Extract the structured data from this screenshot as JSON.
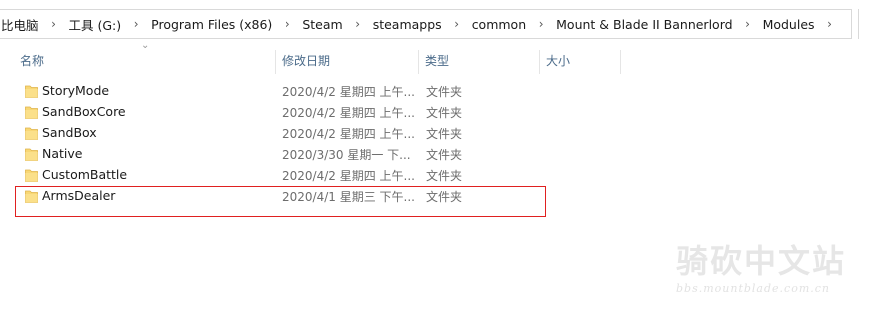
{
  "breadcrumb": [
    "比电脑",
    "工具 (G:)",
    "Program Files (x86)",
    "Steam",
    "steamapps",
    "common",
    "Mount & Blade II Bannerlord",
    "Modules"
  ],
  "columns": {
    "name": "名称",
    "date": "修改日期",
    "type": "类型",
    "size": "大小"
  },
  "files": [
    {
      "name": "StoryMode",
      "date": "2020/4/2 星期四 上午...",
      "type": "文件夹"
    },
    {
      "name": "SandBoxCore",
      "date": "2020/4/2 星期四 上午...",
      "type": "文件夹"
    },
    {
      "name": "SandBox",
      "date": "2020/4/2 星期四 上午...",
      "type": "文件夹"
    },
    {
      "name": "Native",
      "date": "2020/3/30 星期一 下...",
      "type": "文件夹"
    },
    {
      "name": "CustomBattle",
      "date": "2020/4/2 星期四 上午...",
      "type": "文件夹"
    },
    {
      "name": "ArmsDealer",
      "date": "2020/4/1 星期三 下午...",
      "type": "文件夹"
    }
  ],
  "highlighted_item": "ArmsDealer",
  "watermark": {
    "title": "骑砍中文站",
    "url": "bbs.mountblade.com.cn"
  },
  "colors": {
    "highlight_border": "#e02020",
    "folder_yellow": "#f8d775",
    "header_text": "#4b6b8a"
  }
}
